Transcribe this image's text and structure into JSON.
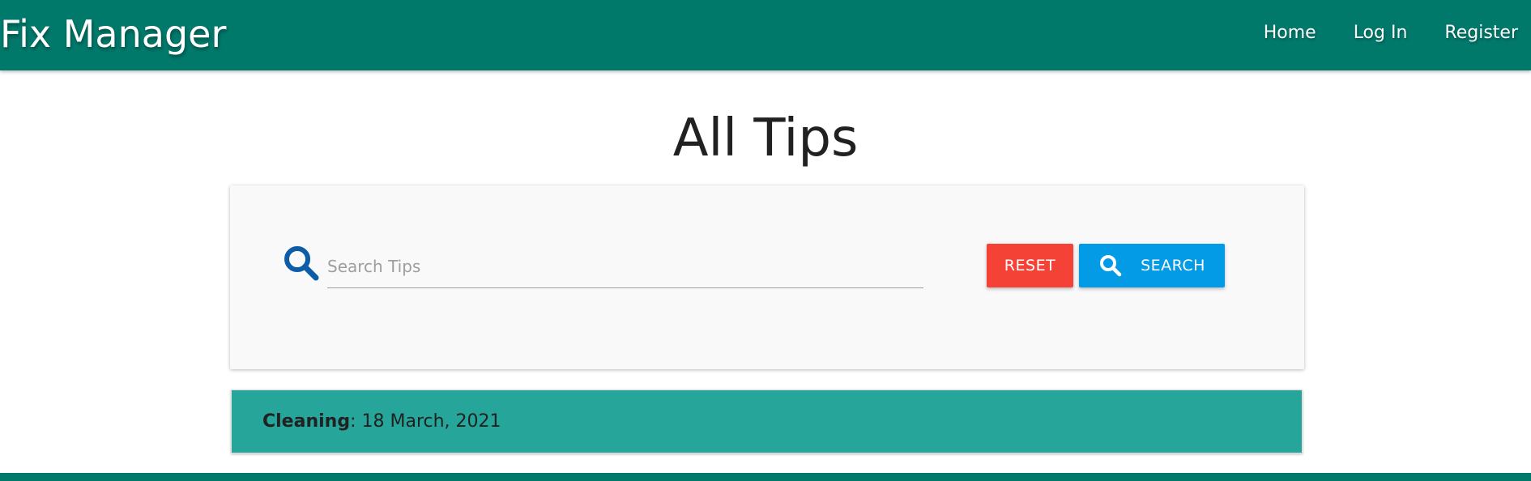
{
  "navbar": {
    "brand": "Fix Manager",
    "links": [
      {
        "label": "Home"
      },
      {
        "label": "Log In"
      },
      {
        "label": "Register"
      }
    ],
    "color": "#00796b"
  },
  "main": {
    "title": "All Tips",
    "search": {
      "placeholder": "Search Tips",
      "value": "",
      "icon": "search-icon",
      "reset_label": "RESET",
      "search_label": "SEARCH"
    },
    "tips": [
      {
        "category": "Cleaning",
        "separator": ":",
        "date": " 18 March, 2021"
      }
    ]
  },
  "colors": {
    "primary": "#00796b",
    "reset": "#f44336",
    "search": "#039be5",
    "tip_row": "#26a69a",
    "search_icon": "#0d5ca8"
  }
}
